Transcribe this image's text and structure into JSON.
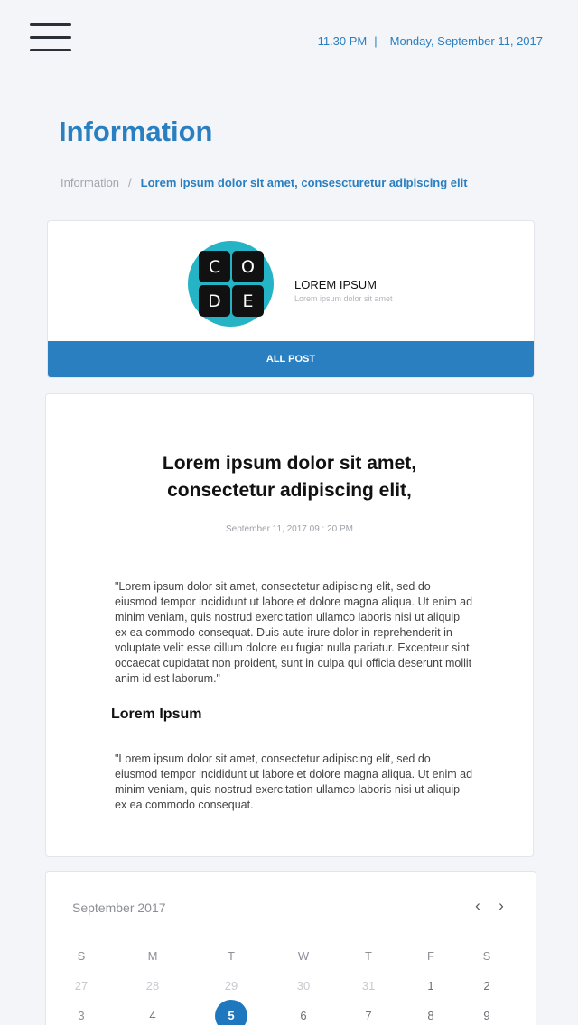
{
  "header": {
    "time": "11.30 PM",
    "separator": "|",
    "date": "Monday, September 11, 2017"
  },
  "page": {
    "title": "Information"
  },
  "breadcrumb": {
    "root": "Information",
    "separator": "/",
    "current": "Lorem ipsum dolor sit amet, consescturetur adipiscing elit"
  },
  "profile": {
    "logo_letters": [
      "C",
      "O",
      "D",
      "E"
    ],
    "name": "LOREM IPSUM",
    "subtitle": "Lorem ipsum dolor sit amet",
    "button_label": "ALL POST"
  },
  "article": {
    "title_line1": "Lorem ipsum dolor sit amet,",
    "title_line2": "consectetur adipiscing elit,",
    "date": "September 11, 2017 09 : 20 PM",
    "paragraph1": "\"Lorem ipsum dolor sit amet, consectetur adipiscing elit, sed do eiusmod tempor incididunt ut labore et dolore magna aliqua. Ut enim ad minim veniam, quis nostrud exercitation ullamco laboris nisi ut aliquip ex ea commodo consequat. Duis aute irure dolor in reprehenderit in voluptate velit esse cillum dolore eu fugiat nulla pariatur. Excepteur sint occaecat cupidatat non proident, sunt in culpa qui officia deserunt mollit anim id est laborum.\"",
    "subheading": "Lorem Ipsum",
    "paragraph2": "\"Lorem ipsum dolor sit amet, consectetur adipiscing elit, sed do eiusmod tempor incididunt ut labore et dolore magna aliqua. Ut enim ad minim veniam, quis nostrud exercitation ullamco laboris nisi ut aliquip ex ea commodo consequat."
  },
  "calendar": {
    "month_label": "September 2017",
    "prev_label": "‹",
    "next_label": "›",
    "weekdays": [
      "S",
      "M",
      "T",
      "W",
      "T",
      "F",
      "S"
    ],
    "week1": [
      "27",
      "28",
      "29",
      "30",
      "31",
      "1",
      "2"
    ],
    "week2": [
      "3",
      "4",
      "5",
      "6",
      "7",
      "8",
      "9"
    ],
    "selected_day": "5"
  },
  "colors": {
    "accent": "#2a7fc1",
    "logo_bg": "#25b3c6",
    "selected_day": "#1f78bd"
  },
  "icons": {
    "menu": "hamburger-icon",
    "prev": "chevron-left-icon",
    "next": "chevron-right-icon"
  }
}
